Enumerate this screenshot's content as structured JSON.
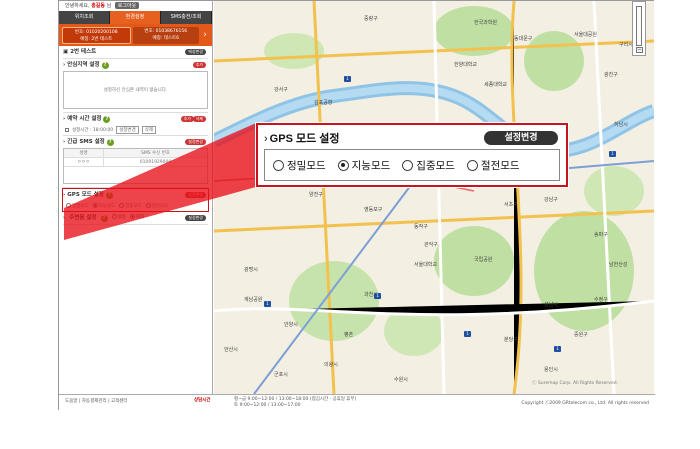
{
  "header": {
    "greeting": "안녕하세요,",
    "user_name": "홍길동",
    "greeting_suffix": "님",
    "logout_label": "로그아웃"
  },
  "nav_tabs": [
    {
      "label": "위치조회",
      "active": false
    },
    {
      "label": "환경설정",
      "active": true
    },
    {
      "label": "SMS충전/조회",
      "active": false
    }
  ],
  "devices": [
    {
      "number": "번호: 01020200108",
      "name": "애칭: 2번 테스트"
    },
    {
      "number": "번호: 01038676156",
      "name": "애칭: 테스트6"
    }
  ],
  "device_title": "2번 테스트",
  "device_edit": "애칭변경",
  "safe_zone": {
    "title": "안심지역 설정",
    "add_label": "추가",
    "empty_note": "설정하신 안심존 내역이 없습니다."
  },
  "schedule": {
    "title": "예약 시간 설정",
    "add_label": "추가",
    "delete_label": "삭제",
    "row_time": "설정시간 : 18:00:00",
    "row_btn1": "설정변경",
    "row_btn2": "삭제"
  },
  "sms": {
    "title": "긴급 SMS 설정",
    "change_label": "설정변경",
    "col1": "성명",
    "col2": "SMS 수신 번호",
    "row_name": "ㅇㅇㅇ",
    "row_number": "01091929000"
  },
  "gps_small": {
    "title": "GPS 모드 설정",
    "change_label": "설정변경",
    "options": [
      "정밀모드",
      "지능모드",
      "집중모드",
      "절전모드"
    ],
    "selected": 1
  },
  "nearby": {
    "title": "주변음 설정",
    "change_label": "설정변경",
    "options": [
      "설정",
      "해제"
    ],
    "selected": 1
  },
  "gps_popup": {
    "title": "GPS 모드 설정",
    "change_label": "설정변경",
    "options": [
      "정밀모드",
      "지능모드",
      "집중모드",
      "절전모드"
    ],
    "selected": 1
  },
  "footer": {
    "links": "도움말 | 자동결제관리 | 고객센터",
    "consult_label": "상담시간",
    "hours_line1": "평~금  9:00~12:00 / 13:00~18:00  (점심시간 · 공휴일 휴무)",
    "hours_line2": "토       9:00~12:00 / 13:00~17:00",
    "copyright": "Copyright ⓒ2009 GRtelecom co., Ltd. All rights reserved"
  },
  "map": {
    "copyright": "ⓒ Suremap Corp. All Rights Reserved.",
    "labels": [
      "중랑구",
      "한국과학원",
      "동대문구",
      "세종대학교",
      "광진구",
      "서울대공원",
      "강서구",
      "김포공항",
      "양천구",
      "영등포구",
      "동작구",
      "관악구",
      "서초구",
      "강남구",
      "송파구",
      "광명시",
      "안양시",
      "과천시",
      "의왕시",
      "성남시",
      "하남시",
      "구리시",
      "분당구",
      "수원시",
      "군포시",
      "안산시",
      "계남공원",
      "국립공원",
      "한양대학교",
      "서울대학교",
      "용인시",
      "평촌",
      "중원구",
      "수정구",
      "남한산성"
    ]
  },
  "colors": {
    "accent": "#e4581a",
    "highlight": "#c8141c",
    "nav_bg": "#444444"
  }
}
